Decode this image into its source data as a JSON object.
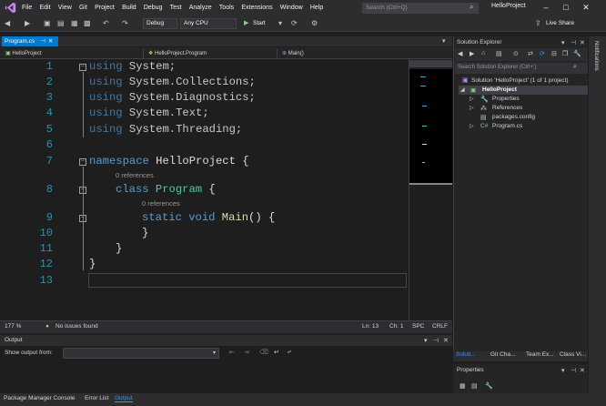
{
  "menu": [
    "File",
    "Edit",
    "View",
    "Git",
    "Project",
    "Build",
    "Debug",
    "Test",
    "Analyze",
    "Tools",
    "Extensions",
    "Window",
    "Help"
  ],
  "search": {
    "placeholder": "Search (Ctrl+Q)"
  },
  "title": "HelloProject",
  "toolbar": {
    "config": "Debug",
    "platform": "Any CPU",
    "start": "Start",
    "liveshare": "Live Share"
  },
  "tab": {
    "name": "Program.cs"
  },
  "nav": {
    "project": "HelloProject",
    "type": "HelloProject.Program",
    "member": "Main()"
  },
  "lines": [
    "1",
    "2",
    "3",
    "4",
    "5",
    "6",
    "7",
    "8",
    "9",
    "10",
    "11",
    "12",
    "13"
  ],
  "code": {
    "l1a": "using",
    "l1b": " System;",
    "l2a": "using",
    "l2b": " System.Collections;",
    "l3a": "using",
    "l3b": " System.Diagnostics;",
    "l4a": "using",
    "l4b": " System.Text;",
    "l5a": "using",
    "l5b": " System.Threading;",
    "l7a": "namespace",
    "l7b": " HelloProject {",
    "ref1": "0 references",
    "l8a": "class",
    "l8b": "Program",
    "l8c": " {",
    "ref2": "0 references",
    "l9a": "static",
    "l9b": " void ",
    "l9c": "Main",
    "l9d": "() {",
    "l10": "}",
    "l11": "}",
    "l12": "}"
  },
  "status": {
    "zoom": "177 %",
    "issues": "No issues found",
    "ln": "Ln: 13",
    "ch": "Ch: 1",
    "spc": "SPC",
    "crlf": "CRLF"
  },
  "output": {
    "title": "Output",
    "show_from": "Show output from:"
  },
  "bottom_tabs": [
    "Package Manager Console",
    "Error List",
    "Output"
  ],
  "solution": {
    "title": "Solution Explorer",
    "search": "Search Solution Explorer (Ctrl+;)",
    "root": "Solution 'HelloProject' (1 of 1 project)",
    "project": "HelloProject",
    "items": [
      "Properties",
      "References",
      "packages.config",
      "Program.cs"
    ]
  },
  "se_tabs": [
    "Soluti...",
    "Git Cha...",
    "Team Ex...",
    "Class Vi..."
  ],
  "properties": {
    "title": "Properties"
  },
  "notifications": "Notifications",
  "colors": {
    "accent": "#007acc",
    "keyword": "#569cd6",
    "type": "#4ec9b0",
    "method": "#dcdcaa",
    "linenum": "#2b91af"
  }
}
